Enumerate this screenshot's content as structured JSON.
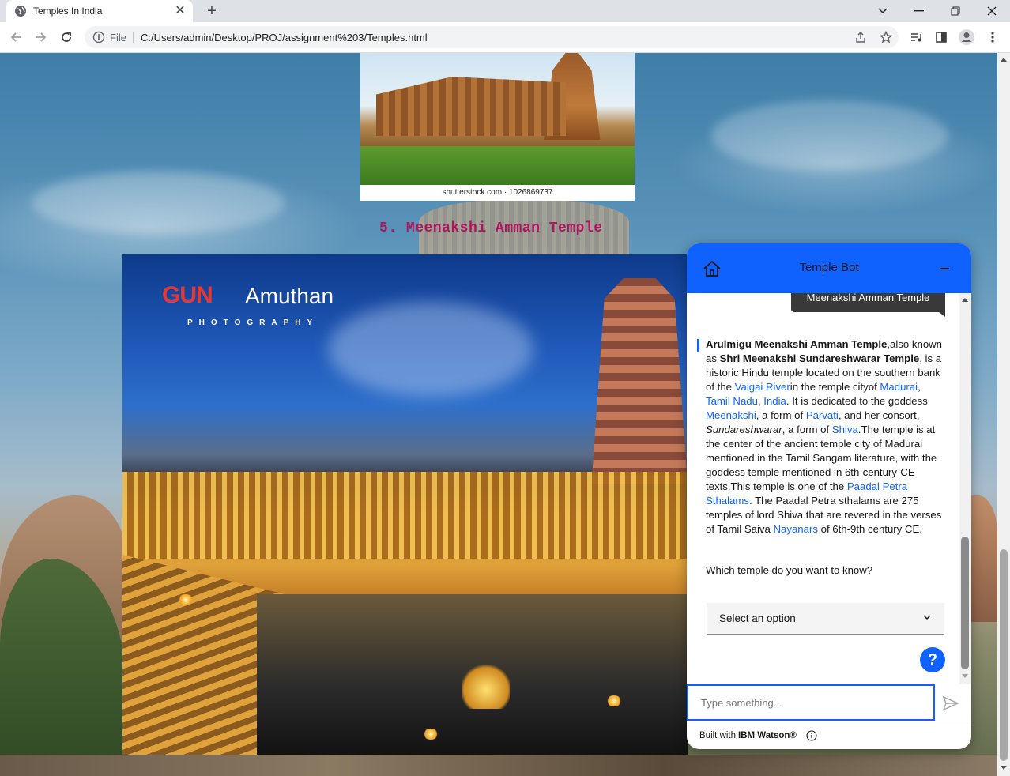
{
  "browser": {
    "tab_title": "Temples In India",
    "tab_close": "✕",
    "new_tab": "+",
    "url_scheme": "File",
    "url": "C:/Users/admin/Desktop/PROJ/assignment%203/Temples.html"
  },
  "page": {
    "photo1_caption": "shutterstock.com · 1026869737",
    "temple_heading": "5. Meenakshi Amman Temple",
    "logo_gun": "GUN",
    "logo_amuthan": "Amuthan",
    "logo_photography": "PHOTOGRAPHY"
  },
  "chat": {
    "title": "Temple Bot",
    "user_message": "Meenakshi Amman Temple",
    "bot": {
      "t1": "Arulmigu Meenakshi Amman Temple",
      "t2": ",also known as ",
      "t3": "Shri Meenakshi Sundareshwarar Temple",
      "t4": ", is a historic Hindu temple located on the southern bank of the ",
      "l_vaigai": "Vaigai River",
      "t5": "in the temple cityof ",
      "l_madurai": "Madurai",
      "t6": ", ",
      "l_tamilnadu": "Tamil Nadu",
      "t7": ", ",
      "l_india": "India",
      "t8": ". It is dedicated to the goddess ",
      "l_meenakshi": "Meenakshi",
      "t9": ", a form of ",
      "l_parvati": "Parvati",
      "t10": ", and her consort, ",
      "t11": "Sundareshwarar",
      "t12": ", a form of ",
      "l_shiva": "Shiva",
      "t13": ".The temple is at the center of the ancient temple city of Madurai mentioned in the Tamil Sangam literature, with the goddess temple mentioned in 6th-century-CE texts.This temple is one of the ",
      "l_paadal": "Paadal Petra Sthalams",
      "t14": ". The Paadal Petra sthalams are 275 temples of lord Shiva that are revered in the verses of Tamil Saiva ",
      "l_nayanars": "Nayanars",
      "t15": " of 6th-9th century CE."
    },
    "question": "Which temple do you want to know?",
    "select_label": "Select an option",
    "help_label": "?",
    "input_placeholder": "Type something...",
    "footer_built": "Built with",
    "footer_brand": "IBM Watson®"
  },
  "colors": {
    "accent": "#0f62fe",
    "heading": "#b0145a",
    "user_bubble": "#393939"
  }
}
